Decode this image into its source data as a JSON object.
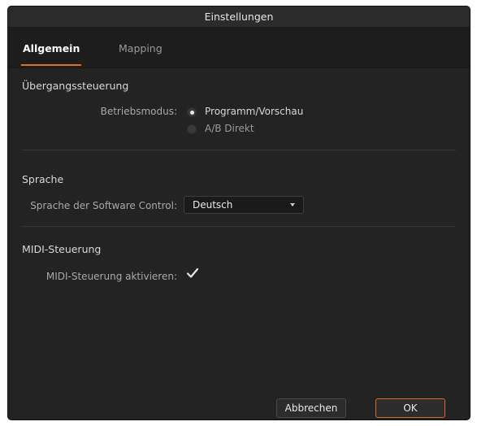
{
  "dialog": {
    "title": "Einstellungen",
    "tabs": [
      {
        "label": "Allgemein",
        "active": true
      },
      {
        "label": "Mapping",
        "active": false
      }
    ]
  },
  "transition": {
    "section_title": "Übergangssteuerung",
    "mode_label": "Betriebsmodus:",
    "options": [
      {
        "label": "Programm/Vorschau",
        "selected": true
      },
      {
        "label": "A/B Direkt",
        "selected": false
      }
    ]
  },
  "language": {
    "section_title": "Sprache",
    "field_label": "Sprache der Software Control:",
    "selected_value": "Deutsch"
  },
  "midi": {
    "section_title": "MIDI-Steuerung",
    "field_label": "MIDI-Steuerung aktivieren:",
    "enabled": true
  },
  "buttons": {
    "cancel_label": "Abbrechen",
    "ok_label": "OK"
  },
  "colors": {
    "accent": "#e26d2a",
    "dialog_bg": "#232323",
    "tabbar_bg": "#1d1d1d"
  },
  "icons": {
    "dropdown": "chevron-down-icon",
    "checkbox": "checkmark-icon",
    "radio": "radio-icon"
  }
}
